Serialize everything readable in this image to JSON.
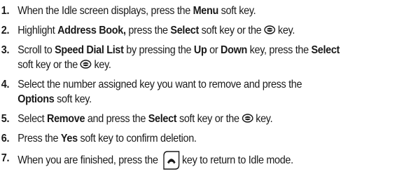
{
  "steps": [
    {
      "num": "1.",
      "parts": [
        {
          "t": "When the Idle screen displays, press the "
        },
        {
          "t": "Menu",
          "b": true
        },
        {
          "t": " soft key."
        }
      ]
    },
    {
      "num": "2.",
      "parts": [
        {
          "t": "Highlight "
        },
        {
          "t": "Address Book,",
          "b": true
        },
        {
          "t": " press the "
        },
        {
          "t": "Select",
          "b": true
        },
        {
          "t": " soft key or the "
        },
        {
          "icon": "ok-key-icon"
        },
        {
          "t": " key."
        }
      ]
    },
    {
      "num": "3.",
      "parts": [
        {
          "t": "Scroll to "
        },
        {
          "t": "Speed Dial List",
          "b": true
        },
        {
          "t": " by pressing the "
        },
        {
          "t": "Up",
          "b": true
        },
        {
          "t": " or "
        },
        {
          "t": "Down",
          "b": true
        },
        {
          "t": " key, press the "
        },
        {
          "t": "Select",
          "b": true
        },
        {
          "br": true
        },
        {
          "t": "soft key or the "
        },
        {
          "icon": "ok-key-icon"
        },
        {
          "t": " key."
        }
      ]
    },
    {
      "num": "4.",
      "parts": [
        {
          "t": "Select the number assigned key you want to remove and press the"
        },
        {
          "br": true
        },
        {
          "t": "Options",
          "b": true
        },
        {
          "t": " soft key."
        }
      ]
    },
    {
      "num": "5.",
      "parts": [
        {
          "t": "Select "
        },
        {
          "t": "Remove",
          "b": true
        },
        {
          "t": " and press the "
        },
        {
          "t": "Select",
          "b": true
        },
        {
          "t": " soft key or the "
        },
        {
          "icon": "ok-key-icon"
        },
        {
          "t": " key."
        }
      ]
    },
    {
      "num": "6.",
      "parts": [
        {
          "t": "Press the "
        },
        {
          "t": "Yes",
          "b": true
        },
        {
          "t": " soft key to confirm deletion."
        }
      ]
    },
    {
      "num": "7.",
      "parts": [
        {
          "t": "When you are finished, press the "
        },
        {
          "icon": "end-key-icon"
        },
        {
          "t": " key to return to Idle mode."
        }
      ]
    }
  ]
}
